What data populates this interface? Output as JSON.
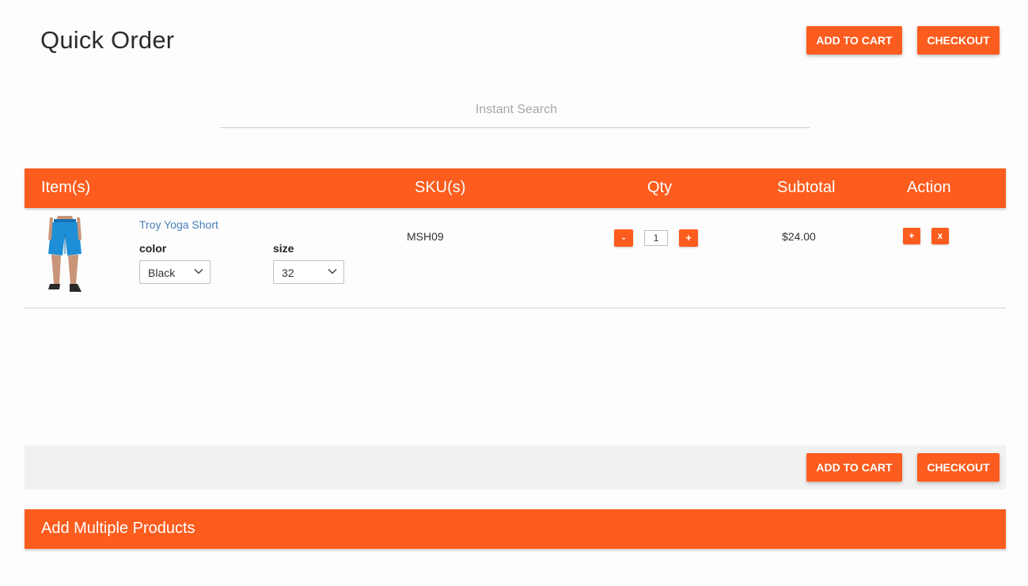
{
  "page": {
    "title": "Quick Order"
  },
  "top_actions": {
    "add_to_cart": "ADD TO CART",
    "checkout": "CHECKOUT"
  },
  "search": {
    "placeholder": "Instant Search"
  },
  "table": {
    "headers": [
      "Item(s)",
      "SKU(s)",
      "Qty",
      "Subtotal",
      "Action"
    ],
    "rows": [
      {
        "name": "Troy Yoga Short",
        "color_label": "color",
        "color_value": "Black",
        "size_label": "size",
        "size_value": "32",
        "sku": "MSH09",
        "qty": "1",
        "qty_decrease": "-",
        "qty_increase": "+",
        "subtotal": "$24.00",
        "action_add": "+",
        "action_remove": "x"
      }
    ]
  },
  "bottom_actions": {
    "add_to_cart": "ADD TO CART",
    "checkout": "CHECKOUT"
  },
  "add_multiple": {
    "label": "Add Multiple Products"
  },
  "colors": {
    "accent": "#fc5c1e",
    "link": "#4a7fb8",
    "product_shorts": "#1e8fd6"
  }
}
